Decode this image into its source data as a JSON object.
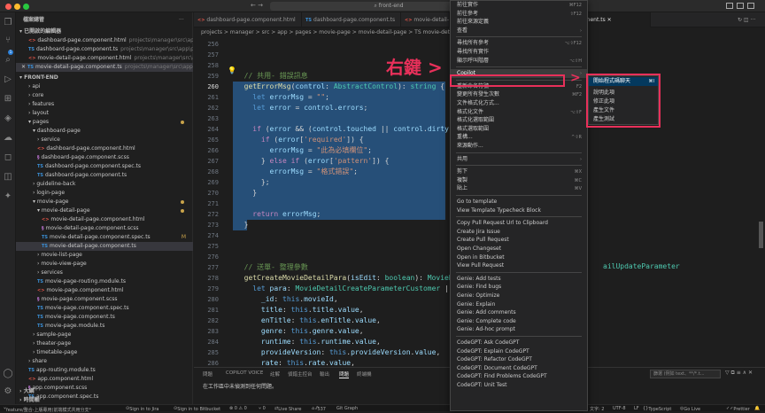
{
  "window": {
    "search_text": "front-end"
  },
  "sidebar": {
    "title": "檔案總管",
    "open_editors_header": "已開啟的編輯器",
    "open_editors": [
      {
        "name": "dashboard-page.component.html",
        "path": "projects\\manager\\src\\app\\p...",
        "type": "ang"
      },
      {
        "name": "dashboard-page.component.ts",
        "path": "projects\\manager\\src\\app\\pa...",
        "type": "ts"
      },
      {
        "name": "movie-detail-page.component.html",
        "path": "projects\\manager\\src\\app\\...",
        "type": "ang"
      },
      {
        "name": "movie-detail-page.component.ts",
        "path": "projects\\manager\\src\\app\\pa...",
        "type": "ts"
      }
    ],
    "project_header": "FRONT-END",
    "tree": [
      {
        "name": "api",
        "indent": 2,
        "kind": "folder"
      },
      {
        "name": "core",
        "indent": 2,
        "kind": "folder"
      },
      {
        "name": "features",
        "indent": 2,
        "kind": "folder"
      },
      {
        "name": "layout",
        "indent": 2,
        "kind": "folder"
      },
      {
        "name": "pages",
        "indent": 2,
        "kind": "folder-open",
        "mark": "dot"
      },
      {
        "name": "dashboard-page",
        "indent": 3,
        "kind": "folder-open"
      },
      {
        "name": "service",
        "indent": 4,
        "kind": "folder"
      },
      {
        "name": "dashboard-page.component.html",
        "indent": 4,
        "kind": "ang"
      },
      {
        "name": "dashboard-page.component.scss",
        "indent": 4,
        "kind": "scss"
      },
      {
        "name": "dashboard-page.component.spec.ts",
        "indent": 4,
        "kind": "ts"
      },
      {
        "name": "dashboard-page.component.ts",
        "indent": 4,
        "kind": "ts"
      },
      {
        "name": "guideline-back",
        "indent": 3,
        "kind": "folder"
      },
      {
        "name": "login-page",
        "indent": 3,
        "kind": "folder"
      },
      {
        "name": "movie-page",
        "indent": 3,
        "kind": "folder-open",
        "mark": "dot"
      },
      {
        "name": "movie-detail-page",
        "indent": 4,
        "kind": "folder-open",
        "mark": "dot"
      },
      {
        "name": "movie-detail-page.component.html",
        "indent": 5,
        "kind": "ang"
      },
      {
        "name": "movie-detail-page.component.scss",
        "indent": 5,
        "kind": "scss"
      },
      {
        "name": "movie-detail-page.component.spec.ts",
        "indent": 5,
        "kind": "ts",
        "mark": "M"
      },
      {
        "name": "movie-detail-page.component.ts",
        "indent": 5,
        "kind": "ts",
        "selected": true
      },
      {
        "name": "movie-list-page",
        "indent": 4,
        "kind": "folder"
      },
      {
        "name": "movie-view-page",
        "indent": 4,
        "kind": "folder"
      },
      {
        "name": "services",
        "indent": 4,
        "kind": "folder"
      },
      {
        "name": "movie-page-routing.module.ts",
        "indent": 4,
        "kind": "ts"
      },
      {
        "name": "movie-page.component.html",
        "indent": 4,
        "kind": "ang"
      },
      {
        "name": "movie-page.component.scss",
        "indent": 4,
        "kind": "scss"
      },
      {
        "name": "movie-page.component.spec.ts",
        "indent": 4,
        "kind": "ts"
      },
      {
        "name": "movie-page.component.ts",
        "indent": 4,
        "kind": "ts"
      },
      {
        "name": "movie-page.module.ts",
        "indent": 4,
        "kind": "ts"
      },
      {
        "name": "sample-page",
        "indent": 3,
        "kind": "folder"
      },
      {
        "name": "theater-page",
        "indent": 3,
        "kind": "folder"
      },
      {
        "name": "timetable-page",
        "indent": 3,
        "kind": "folder"
      },
      {
        "name": "share",
        "indent": 2,
        "kind": "folder"
      },
      {
        "name": "app-routing.module.ts",
        "indent": 2,
        "kind": "ts"
      },
      {
        "name": "app.component.html",
        "indent": 2,
        "kind": "ang"
      },
      {
        "name": "app.component.scss",
        "indent": 2,
        "kind": "scss"
      },
      {
        "name": "app.component.spec.ts",
        "indent": 2,
        "kind": "ts"
      }
    ],
    "outline_header": "大綱",
    "timeline_header": "時間軸"
  },
  "tabs": [
    {
      "label": "dashboard-page.component.html",
      "type": "ang"
    },
    {
      "label": "dashboard-page.component.ts",
      "type": "ts"
    },
    {
      "label": "movie-detail-",
      "type": "ang"
    },
    {
      "label": "onent.ts",
      "type": "ts",
      "active": true
    }
  ],
  "breadcrumb": "projects > manager > src > app > pages > movie-page > movie-detail-page > TS movie-detail-pa",
  "editor": {
    "lines": [
      {
        "n": "256",
        "text": ""
      },
      {
        "n": "257",
        "text": ""
      },
      {
        "n": "258",
        "text": ""
      },
      {
        "n": "259",
        "html": "  <span class='c'>// 共用- 錯誤訊息</span>"
      },
      {
        "n": "260",
        "html": "  <span class='f'>getErrorMsg</span>(<span class='v'>control</span>: <span class='t'>AbstractControl</span>): <span class='t'>string</span> {",
        "cur": true
      },
      {
        "n": "261",
        "html": "    <span class='kb'>let</span> <span class='v'>errorMsg</span> = <span class='s'>\"\"</span>;"
      },
      {
        "n": "262",
        "html": "    <span class='kb'>let</span> <span class='v'>error</span> = <span class='v'>control</span>.<span class='v'>errors</span>;"
      },
      {
        "n": "263",
        "text": ""
      },
      {
        "n": "264",
        "html": "    <span class='k'>if</span> (<span class='v'>error</span> &amp;&amp; (<span class='v'>control</span>.<span class='v'>touched</span> || <span class='v'>control</span>.<span class='v'>dirty</span>)) {"
      },
      {
        "n": "265",
        "html": "      <span class='k'>if</span> (<span class='v'>error</span>[<span class='s'>'required'</span>]) {"
      },
      {
        "n": "266",
        "html": "        <span class='v'>errorMsg</span> = <span class='s'>\"此為必填欄位\"</span>;"
      },
      {
        "n": "267",
        "html": "      } <span class='k'>else if</span> (<span class='v'>error</span>[<span class='s'>'pattern'</span>]) {"
      },
      {
        "n": "268",
        "html": "        <span class='v'>errorMsg</span> = <span class='s'>\"格式錯誤\"</span>;"
      },
      {
        "n": "269",
        "html": "      };"
      },
      {
        "n": "270",
        "html": "    }"
      },
      {
        "n": "271",
        "text": ""
      },
      {
        "n": "272",
        "html": "    <span class='k'>return</span> <span class='v'>errorMsg</span>;"
      },
      {
        "n": "273",
        "html": "  }"
      },
      {
        "n": "274",
        "text": ""
      },
      {
        "n": "275",
        "text": ""
      },
      {
        "n": "276",
        "text": ""
      },
      {
        "n": "277",
        "html": "  <span class='c'>// 送單- 整理參數</span>"
      },
      {
        "n": "278",
        "html": "  <span class='f'>getCreateMovieDetailPara</span>(<span class='v'>isEdit</span>: <span class='t'>boolean</span>): <span class='t'>MovieDeta</span>"
      },
      {
        "n": "279",
        "html": "    <span class='kb'>let</span> <span class='v'>para</span>: <span class='t'>MovieDetailCreateParameterCustomer</span> | <span class='t'>Mov</span>"
      },
      {
        "n": "280",
        "html": "      <span class='v'>_id</span>: <span class='kb'>this</span>.<span class='v'>movieId</span>,"
      },
      {
        "n": "281",
        "html": "      <span class='v'>title</span>: <span class='kb'>this</span>.<span class='v'>title</span>.<span class='v'>value</span>,"
      },
      {
        "n": "282",
        "html": "      <span class='v'>enTitle</span>: <span class='kb'>this</span>.<span class='v'>enTitle</span>.<span class='v'>value</span>,"
      },
      {
        "n": "283",
        "html": "      <span class='v'>genre</span>: <span class='kb'>this</span>.<span class='v'>genre</span>.<span class='v'>value</span>,"
      },
      {
        "n": "284",
        "html": "      <span class='v'>runtime</span>: <span class='kb'>this</span>.<span class='v'>runtime</span>.<span class='v'>value</span>,"
      },
      {
        "n": "285",
        "html": "      <span class='v'>provideVersion</span>: <span class='kb'>this</span>.<span class='v'>provideVersion</span>.<span class='v'>value</span>,"
      },
      {
        "n": "286",
        "html": "      <span class='v'>rate</span>: <span class='kb'>this</span>.<span class='v'>rate</span>.<span class='v'>value</span>,"
      },
      {
        "n": "287",
        "html": "      <span class='v'>director</span>: <span class='kb'>this</span>.<span class='v'>director</span>.<span class='v'>value</span>,"
      }
    ],
    "right_fragment_1": "ailUpdateParameter"
  },
  "context_menu": {
    "items": [
      {
        "label": "前往實作",
        "shortcut": "⌘F12"
      },
      {
        "label": "前往參考",
        "shortcut": "⇧F12"
      },
      {
        "label": "前往來源定義",
        "shortcut": ""
      },
      {
        "label": "查看",
        "shortcut": "›"
      },
      {
        "sep": true
      },
      {
        "label": "尋找所有參考",
        "shortcut": "⌥⇧F12"
      },
      {
        "label": "尋找所有實作",
        "shortcut": ""
      },
      {
        "label": "顯示呼叫階層",
        "shortcut": "⌥⇧H"
      },
      {
        "sep": true
      },
      {
        "label": "Copilot",
        "shortcut": "›",
        "highlight": true
      },
      {
        "sep": true
      },
      {
        "label": "重新命名符號",
        "shortcut": "F2"
      },
      {
        "label": "變更所有發生次數",
        "shortcut": "⌘F2"
      },
      {
        "label": "文件格式化方式...",
        "shortcut": ""
      },
      {
        "label": "格式化文件",
        "shortcut": "⌥⇧F"
      },
      {
        "label": "格式化選取範圍",
        "shortcut": ""
      },
      {
        "label": "格式選取範圍",
        "shortcut": ""
      },
      {
        "label": "重構...",
        "shortcut": "^⇧R"
      },
      {
        "label": "來源動作...",
        "shortcut": ""
      },
      {
        "sep": true
      },
      {
        "label": "共用",
        "shortcut": "›"
      },
      {
        "sep": true
      },
      {
        "label": "剪下",
        "shortcut": "⌘X"
      },
      {
        "label": "複製",
        "shortcut": "⌘C"
      },
      {
        "label": "貼上",
        "shortcut": "⌘V"
      },
      {
        "sep": true
      },
      {
        "label": "Go to template",
        "shortcut": ""
      },
      {
        "label": "View Template Typecheck Block",
        "shortcut": ""
      },
      {
        "sep": true
      },
      {
        "label": "Copy Pull Request Url to Clipboard",
        "shortcut": ""
      },
      {
        "label": "Create Jira Issue",
        "shortcut": ""
      },
      {
        "label": "Create Pull Request",
        "shortcut": ""
      },
      {
        "label": "Open Changeset",
        "shortcut": ""
      },
      {
        "label": "Open in Bitbucket",
        "shortcut": ""
      },
      {
        "label": "View Pull Request",
        "shortcut": ""
      },
      {
        "sep": true
      },
      {
        "label": "Genie: Add tests",
        "shortcut": ""
      },
      {
        "label": "Genie: Find bugs",
        "shortcut": ""
      },
      {
        "label": "Genie: Optimize",
        "shortcut": ""
      },
      {
        "label": "Genie: Explain",
        "shortcut": ""
      },
      {
        "label": "Genie: Add comments",
        "shortcut": ""
      },
      {
        "label": "Genie: Complete code",
        "shortcut": ""
      },
      {
        "label": "Genie: Ad-hoc prompt",
        "shortcut": ""
      },
      {
        "sep": true
      },
      {
        "label": "CodeGPT: Ask CodeGPT",
        "shortcut": ""
      },
      {
        "label": "CodeGPT: Explain CodeGPT",
        "shortcut": ""
      },
      {
        "label": "CodeGPT: Refactor CodeGPT",
        "shortcut": ""
      },
      {
        "label": "CodeGPT: Document CodeGPT",
        "shortcut": ""
      },
      {
        "label": "CodeGPT: Find Problems CodeGPT",
        "shortcut": ""
      },
      {
        "label": "CodeGPT: Unit Test",
        "shortcut": ""
      }
    ]
  },
  "submenu": {
    "items": [
      {
        "label": "開始程式碼聊天",
        "shortcut": "⌘I",
        "highlight": true
      },
      {
        "label": "說明此項",
        "shortcut": ""
      },
      {
        "label": "修正此項",
        "shortcut": ""
      },
      {
        "label": "產生文件",
        "shortcut": ""
      },
      {
        "label": "產生測試",
        "shortcut": ""
      }
    ]
  },
  "annotation": {
    "label": "右鍵 >",
    "arrow2": ">",
    "color": "#e8305a"
  },
  "panel": {
    "tabs": [
      "問題",
      "COPILOT VOICE",
      "註解",
      "偵錯主控台",
      "輸出",
      "問題",
      "終端機"
    ],
    "message": "在工作區中未偵測到任何問題。",
    "filter_placeholder": "篩選 (例如 text、**/*.t..."
  },
  "statusbar": {
    "branch": "feature/整合-上版專用(前端模式共用分支*",
    "jira": "Sign in to Jira",
    "bitbucket": "Sign in to Bitbucket",
    "problems": "⊗ 0 ⚠ 0",
    "ports": "⑂ 0",
    "liveshare": "Live Share",
    "lines": "537",
    "gitgraph": "Git Graph",
    "encoding": "UTF-8",
    "eol": "LF",
    "lang": "TypeScript",
    "golive": "Go Live",
    "prettier": "Prettier",
    "pos": "文字: 2"
  }
}
